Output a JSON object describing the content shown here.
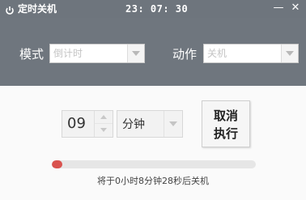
{
  "window": {
    "title": "定时关机",
    "clock": "23: 07: 30",
    "minimize_label": "—",
    "close_label": "✕"
  },
  "settings": {
    "mode_label": "模式",
    "mode_value": "倒计时",
    "action_label": "动作",
    "action_value": "关机"
  },
  "timer": {
    "amount": "09",
    "unit": "分钟"
  },
  "cancel_button": {
    "line1": "取消",
    "line2": "执行"
  },
  "progress": {
    "fraction": 0.05
  },
  "status": "将于0小时8分钟28秒后关机",
  "colors": {
    "header_bg": "#6f767e",
    "progress_fill": "#d9534f"
  },
  "icons": {
    "app": "power-icon",
    "dropdown": "chevron-down-icon"
  }
}
